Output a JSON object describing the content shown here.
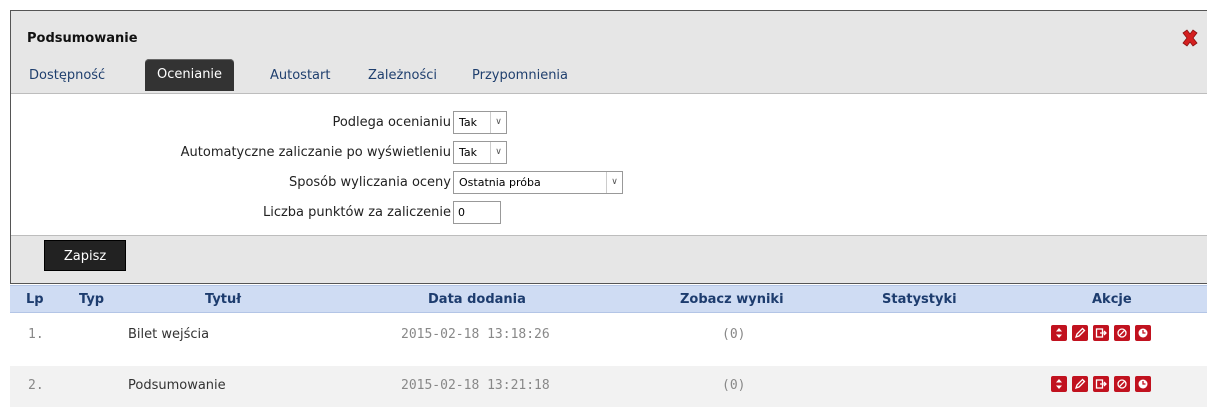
{
  "dialog": {
    "title": "Podsumowanie",
    "tabs": [
      {
        "label": "Dostępność"
      },
      {
        "label": "Ocenianie"
      },
      {
        "label": "Autostart"
      },
      {
        "label": "Zależności"
      },
      {
        "label": "Przypomnienia"
      }
    ],
    "active_tab": "Ocenianie",
    "form": {
      "graded_label": "Podlega ocenianiu",
      "graded_value": "Tak",
      "auto_pass_label": "Automatyczne zaliczanie po wyświetleniu",
      "auto_pass_value": "Tak",
      "grade_method_label": "Sposób wyliczania oceny",
      "grade_method_value": "Ostatnia próba",
      "points_label": "Liczba punktów za zaliczenie",
      "points_value": "0"
    },
    "save_label": "Zapisz"
  },
  "table": {
    "headers": {
      "lp": "Lp",
      "typ": "Typ",
      "title": "Tytuł",
      "date": "Data dodania",
      "results": "Zobacz wyniki",
      "stats": "Statystyki",
      "actions": "Akcje"
    },
    "rows": [
      {
        "lp": "1.",
        "title": "Bilet wejścia",
        "date": "2015-02-18 13:18:26",
        "results": "(0)"
      },
      {
        "lp": "2.",
        "title": "Podsumowanie",
        "date": "2015-02-18 13:21:18",
        "results": "(0)"
      }
    ]
  },
  "colors": {
    "accent_red": "#c1121f",
    "header_bg": "#cfdcf3",
    "header_text": "#1d3c6e",
    "tab_active_bg": "#333333"
  },
  "icons": [
    "close-icon",
    "move-icon",
    "edit-icon",
    "export-icon",
    "disable-icon",
    "clock-icon"
  ]
}
